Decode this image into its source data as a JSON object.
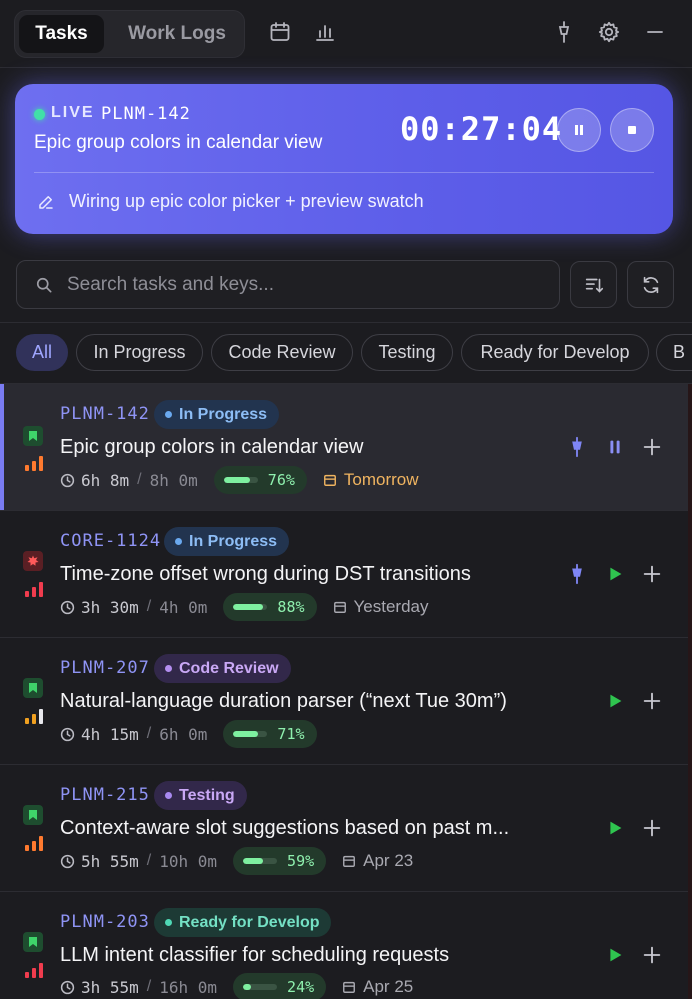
{
  "header": {
    "tabs": [
      {
        "label": "Tasks"
      },
      {
        "label": "Work Logs"
      }
    ]
  },
  "live": {
    "label": "LIVE",
    "key": "PLNM-142",
    "title": "Epic group colors in calendar view",
    "timer": "00:27:04",
    "note": "Wiring up epic color picker + preview swatch"
  },
  "search": {
    "placeholder": "Search tasks and keys..."
  },
  "filters": [
    "All",
    "In Progress",
    "Code Review",
    "Testing",
    "Ready for Develop",
    "B"
  ],
  "tasks": [
    {
      "key": "PLNM-142",
      "status": "In Progress",
      "title": "Epic group colors in calendar view",
      "spent": "6h 8m",
      "estimate": "8h 0m",
      "progress": 76,
      "progress_label": "76%",
      "due": "Tomorrow"
    },
    {
      "key": "CORE-1124",
      "status": "In Progress",
      "title": "Time-zone offset wrong during DST transitions",
      "spent": "3h 30m",
      "estimate": "4h 0m",
      "progress": 88,
      "progress_label": "88%",
      "due": "Yesterday"
    },
    {
      "key": "PLNM-207",
      "status": "Code Review",
      "title": "Natural-language duration parser (“next Tue 30m”)",
      "spent": "4h 15m",
      "estimate": "6h 0m",
      "progress": 71,
      "progress_label": "71%",
      "due": ""
    },
    {
      "key": "PLNM-215",
      "status": "Testing",
      "title": "Context-aware slot suggestions based on past m...",
      "spent": "5h 55m",
      "estimate": "10h 0m",
      "progress": 59,
      "progress_label": "59%",
      "due": "Apr 23"
    },
    {
      "key": "PLNM-203",
      "status": "Ready for Develop",
      "title": "LLM intent classifier for scheduling requests",
      "spent": "3h 55m",
      "estimate": "16h 0m",
      "progress": 24,
      "progress_label": "24%",
      "due": "Apr 25"
    }
  ],
  "colors": {
    "accent": "#6e6ff0",
    "live_dot": "#41e0a8",
    "play": "#2fc44f",
    "progress": "#7ef0a0"
  }
}
